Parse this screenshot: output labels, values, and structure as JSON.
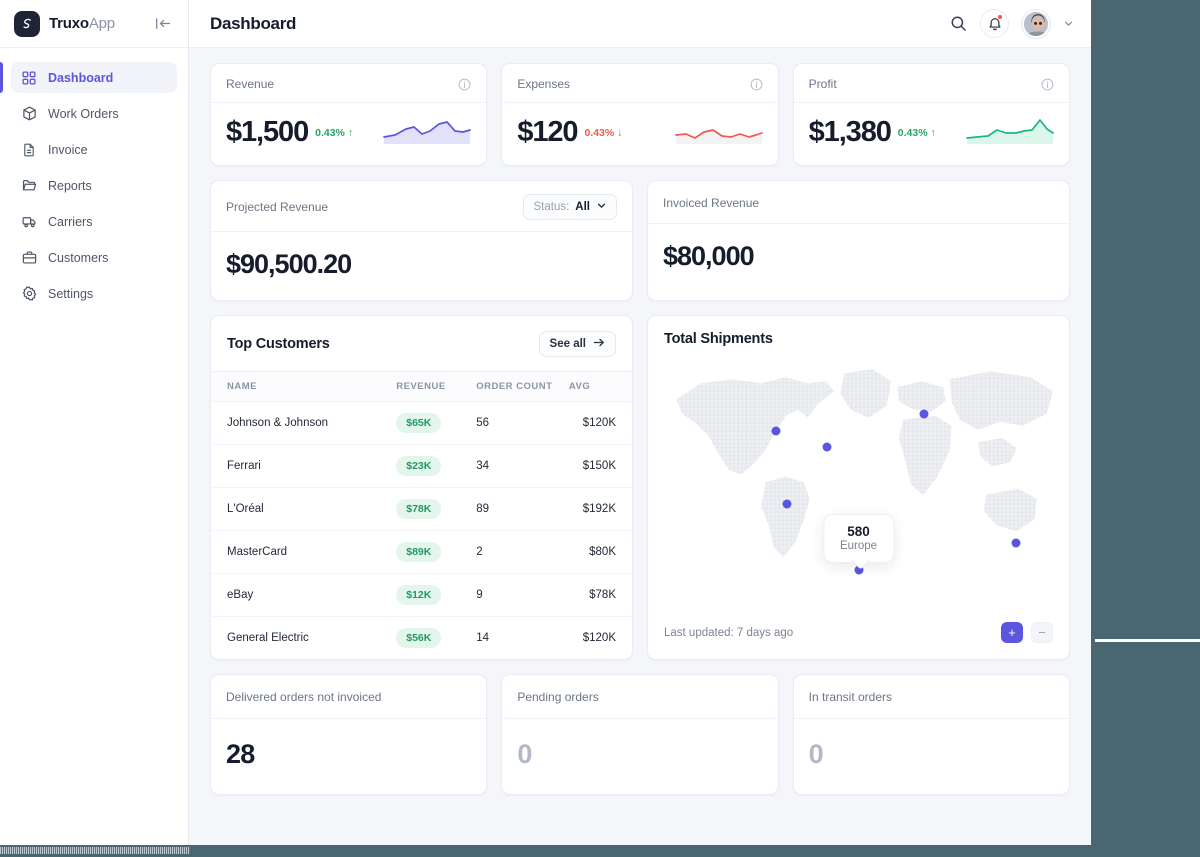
{
  "brand": {
    "name_bold": "Truxo",
    "name_light": "App",
    "logo_icon": "truxo-logo-icon",
    "collapse_icon": "collapse-sidebar-icon"
  },
  "sidebar": {
    "items": [
      {
        "label": "Dashboard",
        "icon": "grid-icon",
        "active": true
      },
      {
        "label": "Work Orders",
        "icon": "box-icon",
        "active": false
      },
      {
        "label": "Invoice",
        "icon": "document-icon",
        "active": false
      },
      {
        "label": "Reports",
        "icon": "folder-icon",
        "active": false
      },
      {
        "label": "Carriers",
        "icon": "truck-icon",
        "active": false
      },
      {
        "label": "Customers",
        "icon": "briefcase-icon",
        "active": false
      },
      {
        "label": "Settings",
        "icon": "gear-icon",
        "active": false
      }
    ]
  },
  "topbar": {
    "title": "Dashboard",
    "search_icon": "search-icon",
    "bell_icon": "notification-bell-icon",
    "has_notification": true,
    "avatar_icon": "user-avatar",
    "caret_icon": "chevron-down-icon"
  },
  "kpis": [
    {
      "label": "Revenue",
      "value": "$1,500",
      "delta": "0.43%",
      "direction": "up",
      "arrow": "↑",
      "info_icon": "info-icon",
      "spark_color": "#5b55e0",
      "spark_fill": "#e2e1fa"
    },
    {
      "label": "Expenses",
      "value": "$120",
      "delta": "0.43%",
      "direction": "down",
      "arrow": "↓",
      "info_icon": "info-icon",
      "spark_color": "#ef5a50",
      "spark_fill": "#f2f3f5"
    },
    {
      "label": "Profit",
      "value": "$1,380",
      "delta": "0.43%",
      "direction": "up",
      "arrow": "↑",
      "info_icon": "info-icon",
      "spark_color": "#17b981",
      "spark_fill": "#ddf6ec"
    }
  ],
  "projected_revenue": {
    "label": "Projected Revenue",
    "value": "$90,500.20",
    "status_label": "Status:",
    "status_value": "All",
    "chevron_icon": "chevron-down-icon"
  },
  "invoiced_revenue": {
    "label": "Invoiced Revenue",
    "value": "$80,000"
  },
  "top_customers": {
    "title": "Top Customers",
    "see_all_label": "See all",
    "see_all_icon": "arrow-right-icon",
    "columns": [
      "NAME",
      "REVENUE",
      "ORDER COUNT",
      "AVG"
    ],
    "rows": [
      {
        "name": "Johnson & Johnson",
        "revenue": "$65K",
        "order_count": "56",
        "avg": "$120K"
      },
      {
        "name": "Ferrari",
        "revenue": "$23K",
        "order_count": "34",
        "avg": "$150K"
      },
      {
        "name": "L'Oréal",
        "revenue": "$78K",
        "order_count": "89",
        "avg": "$192K"
      },
      {
        "name": "MasterCard",
        "revenue": "$89K",
        "order_count": "2",
        "avg": "$80K"
      },
      {
        "name": "eBay",
        "revenue": "$12K",
        "order_count": "9",
        "avg": "$78K"
      },
      {
        "name": "General Electric",
        "revenue": "$56K",
        "order_count": "14",
        "avg": "$120K"
      }
    ]
  },
  "total_shipments": {
    "title": "Total Shipments",
    "last_updated": "Last updated: 7 days ago",
    "zoom_in_label": "+",
    "zoom_out_label": "−",
    "tooltip": {
      "value": "580",
      "region": "Europe"
    },
    "markers": [
      {
        "x": 30.5,
        "y": 29.0
      },
      {
        "x": 42.5,
        "y": 35.0
      },
      {
        "x": 65.5,
        "y": 22.5
      },
      {
        "x": 33.0,
        "y": 56.0
      },
      {
        "x": 50.0,
        "y": 80.5
      },
      {
        "x": 87.5,
        "y": 70.5
      }
    ]
  },
  "bottom_stats": [
    {
      "label": "Delivered orders not invoiced",
      "value": "28",
      "muted": false
    },
    {
      "label": "Pending orders",
      "value": "0",
      "muted": true
    },
    {
      "label": "In transit orders",
      "value": "0",
      "muted": true
    }
  ]
}
